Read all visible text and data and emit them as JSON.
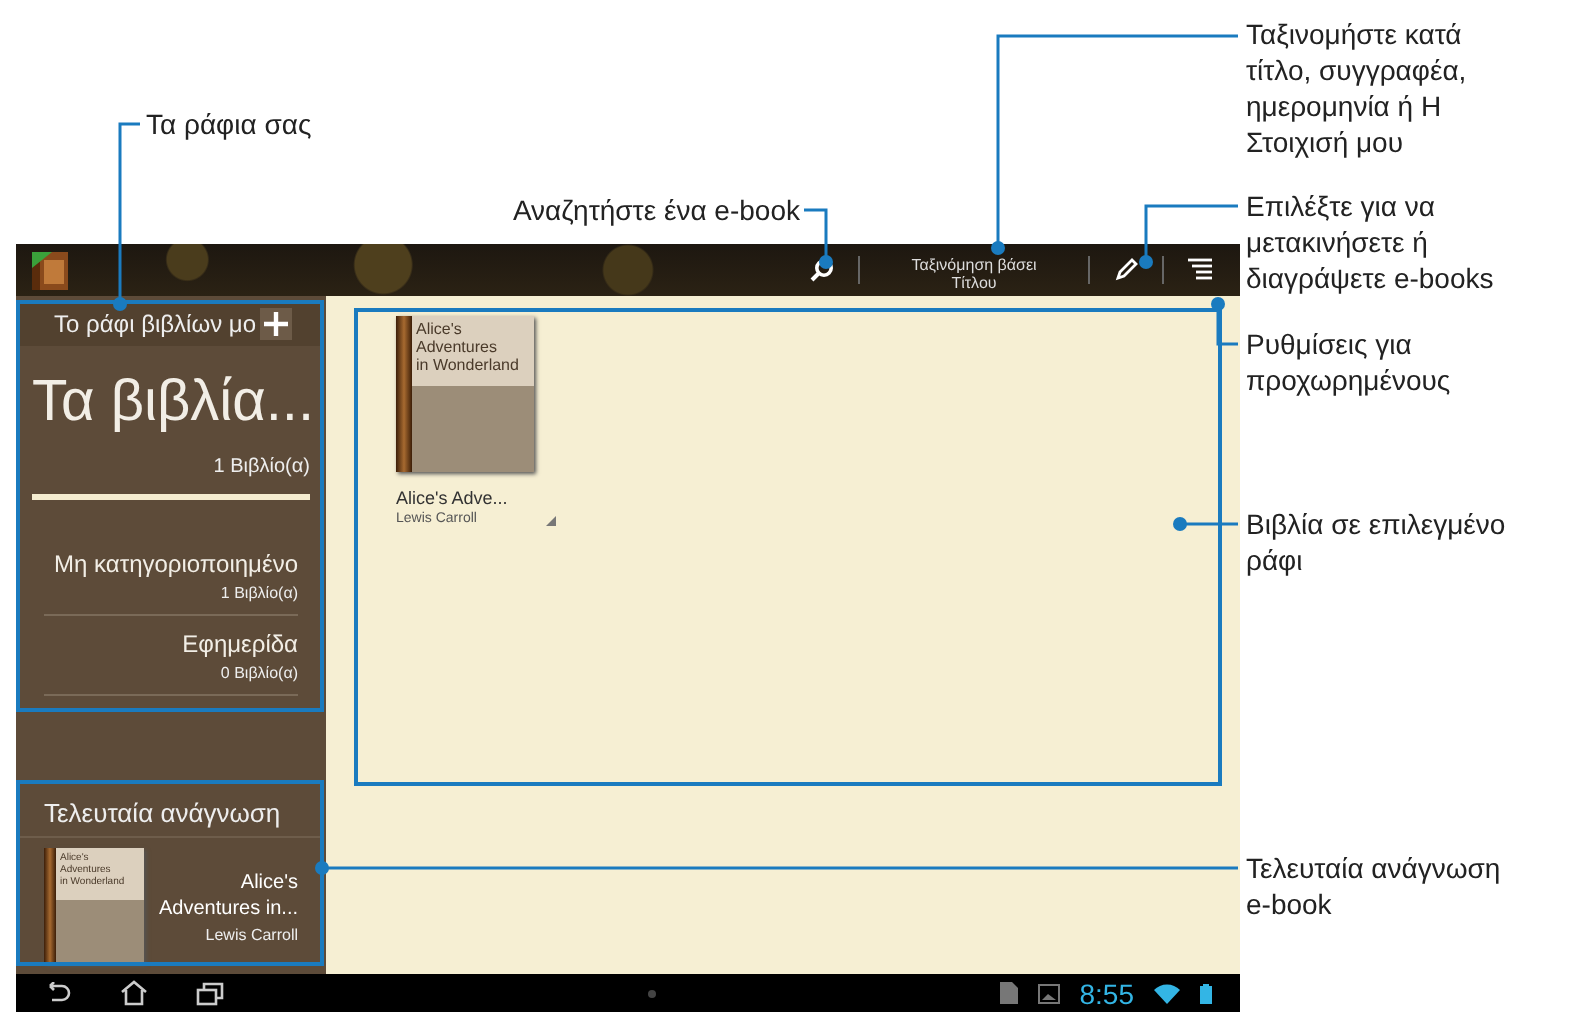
{
  "app": {
    "sort_button": {
      "label": "Ταξινόμηση βάσει\nΤίτλου"
    }
  },
  "sidebar": {
    "shelf_header": "Το ράφι βιβλίων μο",
    "shelves": [
      {
        "name": "Τα βιβλία...",
        "count": "1 Βιβλίο(α)",
        "selected": true
      },
      {
        "name": "Μη κατηγοριοποιημένο",
        "count": "1 Βιβλίο(α)",
        "selected": false
      },
      {
        "name": "Εφημερίδα",
        "count": "0 Βιβλίο(α)",
        "selected": false
      }
    ],
    "recent": {
      "title": "Τελευταία ανάγνωση",
      "cover_text": "Alice's\nAdventures\nin Wonderland",
      "book_title": "Alice's\nAdventures in...",
      "author": "Lewis Carroll"
    }
  },
  "books": [
    {
      "cover_text": "Alice's\nAdventures\nin Wonderland",
      "title": "Alice's Adve...",
      "author": "Lewis Carroll"
    }
  ],
  "status_bar": {
    "time": "8:55"
  },
  "annotations": [
    {
      "text": "Τα ράφια σας"
    },
    {
      "text": "Αναζητήστε ένα e-book"
    },
    {
      "text": "Ταξινομήστε κατά\nτίτλο, συγγραφέα,\nημερομηνία ή Η\nΣτοιχισή μου"
    },
    {
      "text": "Επιλέξτε για να\nμετακινήσετε ή\nδιαγράψετε e-books"
    },
    {
      "text": "Ρυθμίσεις για\nπροχωρημένους"
    },
    {
      "text": "Βιβλία σε επιλεγμένο\nράφι"
    },
    {
      "text": "Τελευταία ανάγνωση\ne-book"
    }
  ]
}
